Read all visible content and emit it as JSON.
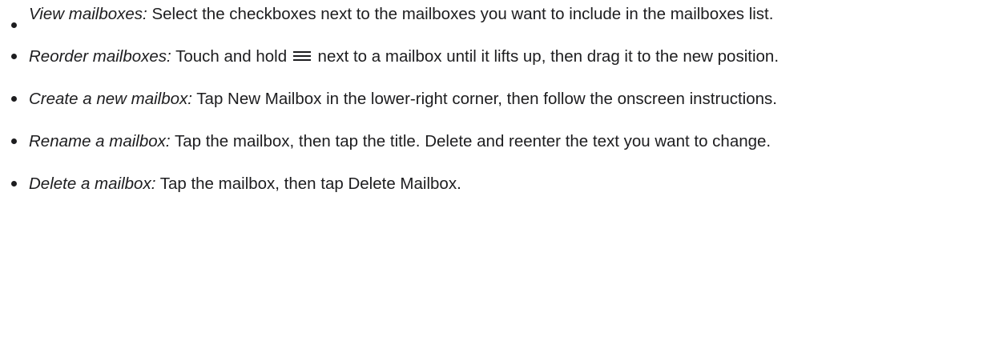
{
  "items": [
    {
      "term": "View mailboxes:",
      "text": " Select the checkboxes next to the mailboxes you want to include in the mailboxes list."
    },
    {
      "term": "Reorder mailboxes:",
      "text_before": " Touch and hold",
      "icon": "reorder-handle-icon",
      "text_after": "next to a mailbox until it lifts up, then drag it to the new position."
    },
    {
      "term": "Create a new mailbox:",
      "text": " Tap New Mailbox in the lower-right corner, then follow the onscreen instructions."
    },
    {
      "term": "Rename a mailbox:",
      "text": " Tap the mailbox, then tap the title. Delete and reenter the text you want to change."
    },
    {
      "term": "Delete a mailbox:",
      "text": " Tap the mailbox, then tap Delete Mailbox."
    }
  ],
  "colors": {
    "text": "#1d1d1f",
    "background": "#ffffff"
  }
}
